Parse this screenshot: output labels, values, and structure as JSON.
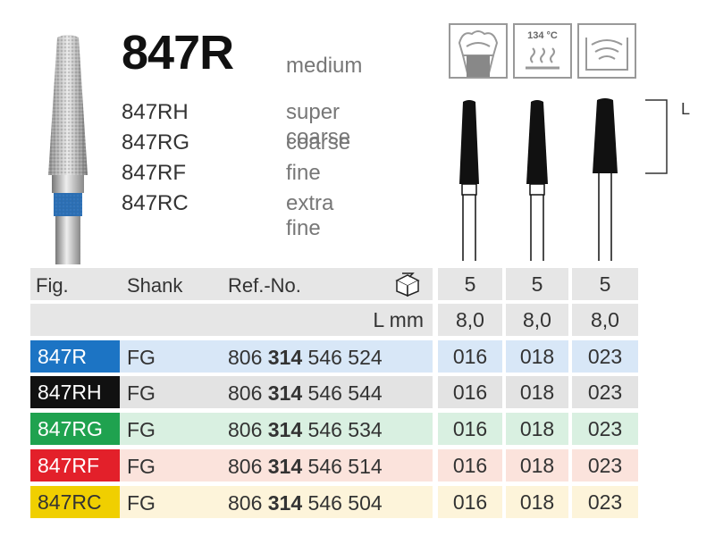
{
  "product": {
    "code": "847R",
    "grit": "medium",
    "variants": [
      {
        "code": "847RH",
        "grit": "super coarse"
      },
      {
        "code": "847RG",
        "grit": "coarse"
      },
      {
        "code": "847RF",
        "grit": "fine"
      },
      {
        "code": "847RC",
        "grit": "extra fine"
      }
    ]
  },
  "icons": {
    "tooth": "tooth-crown-icon",
    "sterilize_label": "134 °C",
    "sterilize": "autoclave-icon",
    "ultrasonic": "ultrasonic-bath-icon",
    "package": "package-box-icon"
  },
  "dimension_label": "L",
  "table": {
    "headers": {
      "fig": "Fig.",
      "shank": "Shank",
      "ref": "Ref.-No."
    },
    "pack_qty": [
      "5",
      "5",
      "5"
    ],
    "length_label": "L mm",
    "lengths": [
      "8,0",
      "8,0",
      "8,0"
    ],
    "rows": [
      {
        "fig": "847R",
        "shank": "FG",
        "ref_prefix": "806",
        "ref_bold": "314",
        "ref_suffix": "546 524",
        "sizes": [
          "016",
          "018",
          "023"
        ],
        "color": "#1c74c4",
        "bg": "#d8e7f7"
      },
      {
        "fig": "847RH",
        "shank": "FG",
        "ref_prefix": "806",
        "ref_bold": "314",
        "ref_suffix": "546 544",
        "sizes": [
          "016",
          "018",
          "023"
        ],
        "color": "#111111",
        "bg": "#e3e3e3"
      },
      {
        "fig": "847RG",
        "shank": "FG",
        "ref_prefix": "806",
        "ref_bold": "314",
        "ref_suffix": "546 534",
        "sizes": [
          "016",
          "018",
          "023"
        ],
        "color": "#1fa24f",
        "bg": "#d9f0e1"
      },
      {
        "fig": "847RF",
        "shank": "FG",
        "ref_prefix": "806",
        "ref_bold": "314",
        "ref_suffix": "546 514",
        "sizes": [
          "016",
          "018",
          "023"
        ],
        "color": "#e3202a",
        "bg": "#fbe3dc"
      },
      {
        "fig": "847RC",
        "shank": "FG",
        "ref_prefix": "806",
        "ref_bold": "314",
        "ref_suffix": "546 504",
        "sizes": [
          "016",
          "018",
          "023"
        ],
        "color": "#f0cf00",
        "bg": "#fdf4da"
      }
    ]
  }
}
